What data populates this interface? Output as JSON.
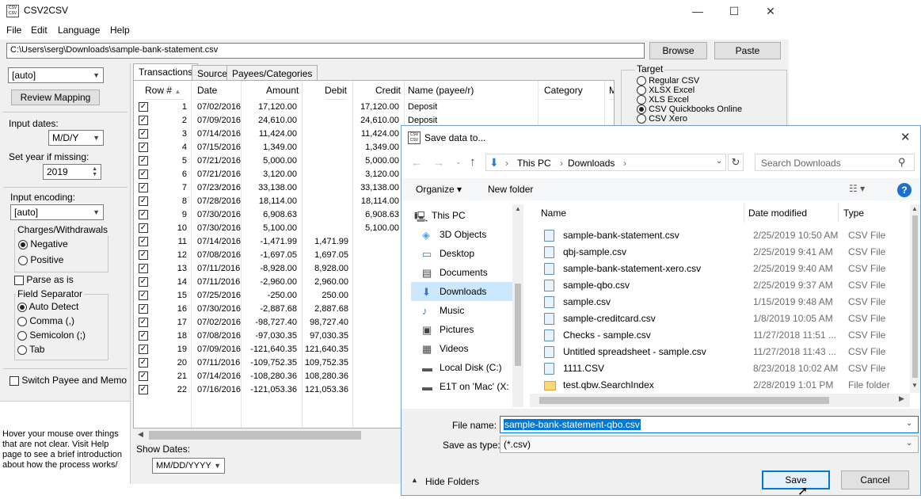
{
  "app": {
    "icon_text": "CSV CSV",
    "title": "CSV2CSV",
    "window_controls": [
      "—",
      "☐",
      "✕"
    ],
    "menu": [
      "File",
      "Edit",
      "Language",
      "Help"
    ],
    "path": "C:\\Users\\serg\\Downloads\\sample-bank-statement.csv",
    "browse_label": "Browse",
    "paste_label": "Paste"
  },
  "left": {
    "mode": "[auto]",
    "review_label": "Review Mapping",
    "input_dates_label": "Input dates:",
    "date_format": "M/D/Y",
    "set_year_label": "Set year if missing:",
    "year": "2019",
    "encoding_label": "Input encoding:",
    "encoding": "[auto]",
    "charges_label": "Charges/Withdrawals",
    "negative_label": "Negative",
    "positive_label": "Positive",
    "parse_as_is_label": "Parse as is",
    "field_sep_label": "Field Separator",
    "sep_options": [
      "Auto Detect",
      "Comma (,)",
      "Semicolon (;)",
      "Tab"
    ],
    "switch_label": "Switch Payee and Memo",
    "help_text": "Hover your mouse over things that are not clear. Visit Help page to see a brief introduction about how the process works/"
  },
  "tabs": [
    "Transactions",
    "Source",
    "Payees/Categories"
  ],
  "grid": {
    "headers": [
      "Row #",
      "Date",
      "Amount",
      "Debit",
      "Credit",
      "Name (payee/r)",
      "Category",
      "M"
    ],
    "rows": [
      [
        "1",
        "07/02/2016",
        "17,120.00",
        "",
        "17,120.00",
        "Deposit"
      ],
      [
        "2",
        "07/09/2016",
        "24,610.00",
        "",
        "24,610.00",
        "Deposit"
      ],
      [
        "3",
        "07/14/2016",
        "11,424.00",
        "",
        "11,424.00",
        ""
      ],
      [
        "4",
        "07/15/2016",
        "1,349.00",
        "",
        "1,349.00",
        ""
      ],
      [
        "5",
        "07/21/2016",
        "5,000.00",
        "",
        "5,000.00",
        ""
      ],
      [
        "6",
        "07/21/2016",
        "3,120.00",
        "",
        "3,120.00",
        ""
      ],
      [
        "7",
        "07/23/2016",
        "33,138.00",
        "",
        "33,138.00",
        ""
      ],
      [
        "8",
        "07/28/2016",
        "18,114.00",
        "",
        "18,114.00",
        ""
      ],
      [
        "9",
        "07/30/2016",
        "6,908.63",
        "",
        "6,908.63",
        ""
      ],
      [
        "10",
        "07/30/2016",
        "5,100.00",
        "",
        "5,100.00",
        ""
      ],
      [
        "11",
        "07/14/2016",
        "-1,471.99",
        "1,471.99",
        "",
        ""
      ],
      [
        "12",
        "07/08/2016",
        "-1,697.05",
        "1,697.05",
        "",
        ""
      ],
      [
        "13",
        "07/11/2016",
        "-8,928.00",
        "8,928.00",
        "",
        ""
      ],
      [
        "14",
        "07/11/2016",
        "-2,960.00",
        "2,960.00",
        "",
        ""
      ],
      [
        "15",
        "07/25/2016",
        "-250.00",
        "250.00",
        "",
        ""
      ],
      [
        "16",
        "07/30/2016",
        "-2,887.68",
        "2,887.68",
        "",
        ""
      ],
      [
        "17",
        "07/02/2016",
        "-98,727.40",
        "98,727.40",
        "",
        ""
      ],
      [
        "18",
        "07/08/2016",
        "-97,030.35",
        "97,030.35",
        "",
        ""
      ],
      [
        "19",
        "07/09/2016",
        "-121,640.35",
        "121,640.35",
        "",
        ""
      ],
      [
        "20",
        "07/11/2016",
        "-109,752.35",
        "109,752.35",
        "",
        ""
      ],
      [
        "21",
        "07/14/2016",
        "-108,280.36",
        "108,280.36",
        "",
        ""
      ],
      [
        "22",
        "07/16/2016",
        "-121,053.36",
        "121,053.36",
        "",
        ""
      ]
    ]
  },
  "show_dates_label": "Show Dates:",
  "show_dates_format": "MM/DD/YYYY",
  "target": {
    "label": "Target",
    "options": [
      "Regular CSV",
      "XLSX Excel",
      "XLS Excel",
      "CSV Quickbooks Online",
      "CSV Xero"
    ],
    "selected": 3
  },
  "dialog": {
    "icon_text": "CSV CSV",
    "title": "Save data to...",
    "breadcrumb": [
      "This PC",
      "Downloads"
    ],
    "search_placeholder": "Search Downloads",
    "organize_label": "Organize ▾",
    "new_folder_label": "New folder",
    "nav": [
      {
        "label": "This PC",
        "icon": "computer-icon"
      },
      {
        "label": "3D Objects",
        "icon": "cube-icon"
      },
      {
        "label": "Desktop",
        "icon": "desktop-icon"
      },
      {
        "label": "Documents",
        "icon": "document-icon"
      },
      {
        "label": "Downloads",
        "icon": "download-icon"
      },
      {
        "label": "Music",
        "icon": "music-icon"
      },
      {
        "label": "Pictures",
        "icon": "picture-icon"
      },
      {
        "label": "Videos",
        "icon": "video-icon"
      },
      {
        "label": "Local Disk (C:)",
        "icon": "disk-icon"
      },
      {
        "label": "E1T on 'Mac' (X:",
        "icon": "network-drive-icon"
      }
    ],
    "columns": [
      "Name",
      "Date modified",
      "Type"
    ],
    "files": [
      [
        "sample-bank-statement.csv",
        "2/25/2019 10:50 AM",
        "CSV File"
      ],
      [
        "qbj-sample.csv",
        "2/25/2019 9:41 AM",
        "CSV File"
      ],
      [
        "sample-bank-statement-xero.csv",
        "2/25/2019 9:40 AM",
        "CSV File"
      ],
      [
        "sample-qbo.csv",
        "2/25/2019 9:37 AM",
        "CSV File"
      ],
      [
        "sample.csv",
        "1/15/2019 9:48 AM",
        "CSV File"
      ],
      [
        "sample-creditcard.csv",
        "1/8/2019 10:05 AM",
        "CSV File"
      ],
      [
        "Checks - sample.csv",
        "11/27/2018 11:51 ...",
        "CSV File"
      ],
      [
        "Untitled spreadsheet - sample.csv",
        "11/27/2018 11:43 ...",
        "CSV File"
      ],
      [
        "1111.CSV",
        "8/23/2018 10:02 AM",
        "CSV File"
      ],
      [
        "test.qbw.SearchIndex",
        "2/28/2019 1:01 PM",
        "File folder"
      ]
    ],
    "filename_label": "File name:",
    "filename": "sample-bank-statement-qbo.csv",
    "savetype_label": "Save as type:",
    "savetype": "(*.csv)",
    "hide_folders_label": "Hide Folders",
    "save_label": "Save",
    "cancel_label": "Cancel"
  }
}
